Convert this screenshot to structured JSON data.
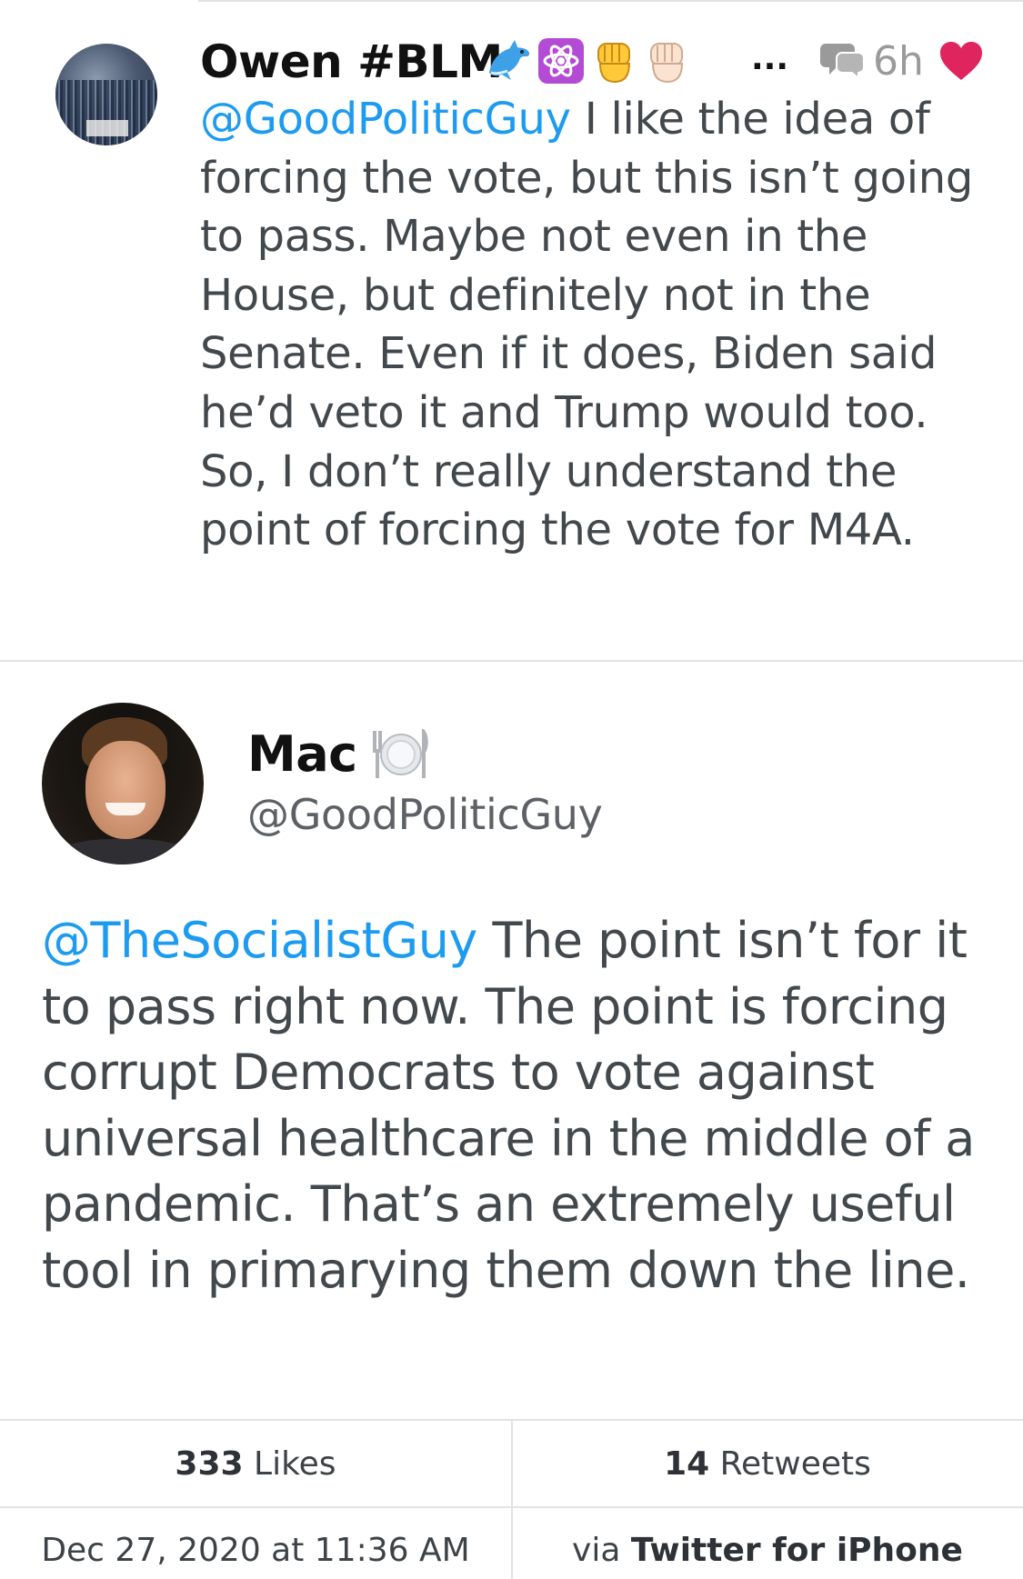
{
  "reply": {
    "display_name": "Owen #BLM",
    "emojis": [
      "dolphin",
      "atom-symbol",
      "raised-fist-yellow",
      "raised-fist-light"
    ],
    "more": "...",
    "time": "6h",
    "mention": "@GoodPoliticGuy",
    "body": " I like the idea of forcing the vote, but this isn’t going to pass. Maybe not even in the House, but definitely not in the Senate. Even if it does, Biden said he’d veto it and Trump would too. So, I don’t really understand the point of forcing the vote for M4A."
  },
  "tweet": {
    "display_name": "Mac",
    "name_emoji": "fork-knife-plate",
    "handle": "@GoodPoliticGuy",
    "mention": "@TheSocialistGuy",
    "body": " The point isn’t for it to pass right now. The point is forcing corrupt Democrats to vote against universal healthcare in the middle of a pandemic. That’s an extremely useful tool in primarying them down the line.",
    "likes_count": "333",
    "likes_label": " Likes",
    "retweets_count": "14",
    "retweets_label": " Retweets",
    "timestamp": "Dec 27, 2020 at 11:36 AM",
    "via_prefix": "via ",
    "client": "Twitter for iPhone"
  },
  "colors": {
    "mention": "#1d9bf0",
    "heart": "#e0245e",
    "divider": "#e3e3e3"
  }
}
